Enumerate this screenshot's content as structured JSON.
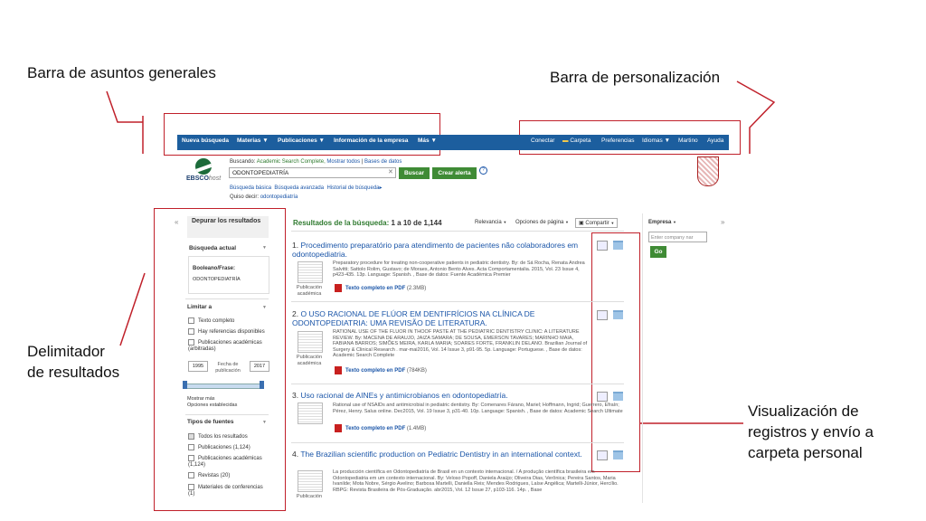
{
  "annotations": {
    "general_bar": "Barra de asuntos generales",
    "personal_bar": "Barra de personalización",
    "limiter_line1": "Delimitador",
    "limiter_line2": "de resultados",
    "records_line1": "Visualización de",
    "records_line2": "registros y envío a",
    "records_line3": "carpeta personal"
  },
  "colors": {
    "annotation_red": "#c0202a",
    "navbar_blue": "#1c5e9e",
    "button_green": "#3f8b35"
  },
  "navbar": {
    "left": [
      "Nueva búsqueda",
      "Materias",
      "Publicaciones",
      "Información de la empresa",
      "Más"
    ],
    "right": [
      "Conectar",
      "Carpeta",
      "Preferencias",
      "Idiomas",
      "Martino",
      "Ayuda"
    ]
  },
  "search": {
    "logo": "EBSCO",
    "logo_suffix": "host",
    "searching_label": "Buscando:",
    "database": "Academic Search Complete,",
    "show_all": "Mostrar todos",
    "databases": "Bases de datos",
    "query": "ODONTOPEDIATRÍA",
    "search_btn": "Buscar",
    "alert_btn": "Crear alerta",
    "basic": "Búsqueda básica",
    "advanced": "Búsqueda avanzada",
    "history": "Historial de búsqueda",
    "did_you_mean": "Quiso decir:",
    "suggestion": "odontopediatría"
  },
  "sidebar": {
    "refine_title": "Depurar los resultados",
    "current_search": "Búsqueda actual",
    "boolean_label": "Booleano/Frase:",
    "boolean_value": "ODONTOPEDIATRÍA",
    "limit_to": "Limitar a",
    "limits": [
      "Texto completo",
      "Hay referencias disponibles",
      "Publicaciones académicas (arbitradas)"
    ],
    "date_from": "1995",
    "date_label": "Fecha de publicación",
    "date_to": "2017",
    "show_more": "Mostrar más",
    "options": "Opciones establecidas",
    "source_types": "Tipos de fuentes",
    "sources": [
      "Todos los resultados",
      "Publicaciones (1,124)",
      "Publicaciones académicas (1,124)",
      "Revistas (20)",
      "Materiales de conferencias (1)"
    ]
  },
  "results": {
    "header_label": "Resultados de la búsqueda:",
    "header_range": "1 a 10 de 1,144",
    "relevance": "Relevancia",
    "page_options": "Opciones de página",
    "share": "Compartir",
    "items": [
      {
        "num": "1.",
        "title": "Procedimento preparatório para atendimento de pacientes não colaboradores em odontopediatria.",
        "body": "Preparatory procedure for treating non-cooperative patients in pediatric dentistry. By: de Sá Rocha, Renata Andrea Salvitti; Sattolo Rolim, Gustavo; de Moraes, Antonio Bento Alves. Acta Comportamentalia. 2015, Vol. 23 Issue 4, p423-435. 13p. Language: Spanish. , Base de datos: Fuente Académica Premier",
        "type": "Publicación académica",
        "pdf": "Texto completo en PDF",
        "size": "(2.3MB)"
      },
      {
        "num": "2.",
        "title": "O USO RACIONAL DE FLÚOR EM DENTIFRÍCIOS NA CLÍNICA DE ODONTOPEDIATRIA: UMA REVISÃO DE LITERATURA.",
        "body": "RATIONAL USE OF THE FLUOR IN THOOF PASTE AT THE PEDIATRIC DENTISTRY CLINIC: A LITERATURE REVIEW. By: MACENA DE ARAUJO, JAIZA SAMARA; DE SOUSA, EMERSON TAVARES; MARINHO MAIA, FABIANA BARROS; SIMÕES MEIRA, KARLA MARIA; SOARES FORTE, FRANKLIN DELANO. Brazilian Journal of Surgery & Clinical Research . mar-mai2016, Vol. 14 Issue 3, p91-95. 5p. Language: Portuguese. , Base de datos: Academic Search Complete",
        "type": "Publicación académica",
        "pdf": "Texto completo en PDF",
        "size": "(784KB)"
      },
      {
        "num": "3.",
        "title": "Uso racional de AINEs y antimicrobianos en odontopediatría.",
        "body": "Rational use of NSAIDs and antimicrobial in pediatric dentistry. By: Comenares Fárano, Mariel; Hoffmann, Ingrid; Guerrero, Efraín; Pérez, Henry. Salus online. Dec2015, Vol. 19 Issue 3, p31-40. 10p. Language: Spanish. , Base de datos: Academic Search Ultimate",
        "type": "",
        "pdf": "Texto completo en PDF",
        "size": "(1.4MB)"
      },
      {
        "num": "4.",
        "title": "The Brazilian scientific production on Pediatric Dentistry in an international context.",
        "body": "La producción científica en Odontopediatría de Brasil en un contexto internacional. / A produção científica brasileira em Odontopediatria em um contexto internacional. By: Veloso Popoff, Daniela Araújo; Oliveira Dias, Verônica; Pereira Santos, Maria Ivanilde; Mota Nobre, Sérgio Avelino; Barbosa Martelli, Daniella Reis; Mendes Rodrigues, Laíse Angélica; Martelli-Júnior, Hercílio. RBPG: Revista Brasileira de Pós-Graduação. abr2015, Vol. 12 Issue 27, p103-116. 14p. , Base",
        "type": "Publicación",
        "pdf": "",
        "size": ""
      }
    ]
  },
  "right_panel": {
    "company_label": "Empresa",
    "company_placeholder": "Enter company nar",
    "go_btn": "Go"
  }
}
